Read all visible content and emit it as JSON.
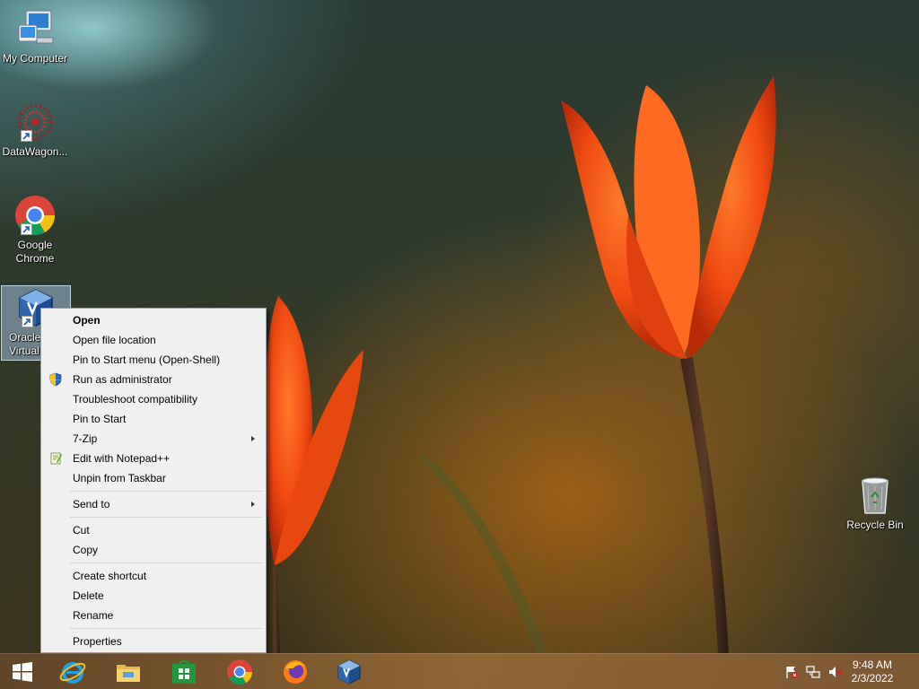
{
  "desktop": {
    "icons": [
      {
        "label": "My Computer",
        "icon": "computer-icon"
      },
      {
        "label": "DataWagon...",
        "icon": "datawagon-icon"
      },
      {
        "label": "Google Chrome",
        "icon": "chrome-icon"
      },
      {
        "label": "Oracle VM VirtualBox",
        "label_visible": "Oracle Virtual",
        "icon": "virtualbox-icon"
      },
      {
        "label": "Recycle Bin",
        "icon": "recycle-bin-icon"
      }
    ]
  },
  "context_menu": {
    "groups": [
      [
        {
          "label": "Open",
          "bold": true
        },
        {
          "label": "Open file location"
        },
        {
          "label": "Pin to Start menu (Open-Shell)"
        },
        {
          "label": "Run as administrator",
          "icon": "uac-shield-icon"
        },
        {
          "label": "Troubleshoot compatibility"
        },
        {
          "label": "Pin to Start"
        },
        {
          "label": "7-Zip",
          "submenu": true
        },
        {
          "label": "Edit with Notepad++",
          "icon": "notepadpp-icon"
        },
        {
          "label": "Unpin from Taskbar"
        }
      ],
      [
        {
          "label": "Send to",
          "submenu": true
        }
      ],
      [
        {
          "label": "Cut"
        },
        {
          "label": "Copy"
        }
      ],
      [
        {
          "label": "Create shortcut"
        },
        {
          "label": "Delete"
        },
        {
          "label": "Rename"
        }
      ],
      [
        {
          "label": "Properties"
        }
      ]
    ]
  },
  "taskbar": {
    "pinned": [
      "start-icon",
      "internet-explorer-icon",
      "file-explorer-icon",
      "store-icon",
      "chrome-icon",
      "firefox-icon",
      "virtualbox-icon"
    ],
    "tray": [
      "action-center-flag-icon",
      "network-icon",
      "volume-muted-icon"
    ],
    "clock": {
      "time": "9:48 AM",
      "date": "2/3/2022"
    }
  },
  "colors": {
    "menu_bg": "#f0f0f0",
    "tulip_orange": "#ff5a1c",
    "taskbar": "#8a6238"
  }
}
